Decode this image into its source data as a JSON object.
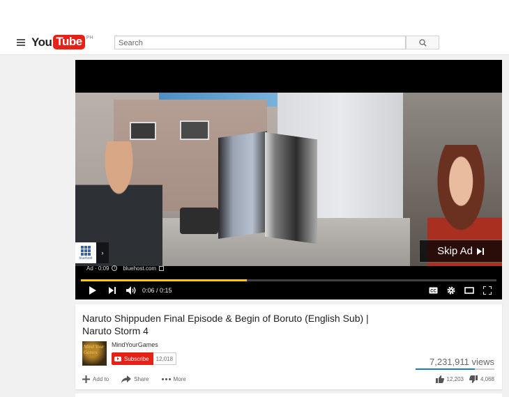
{
  "header": {
    "logo_you": "You",
    "logo_tube": "Tube",
    "logo_region": "PH",
    "search_placeholder": "Search",
    "icons": {
      "menu": "hamburger-menu-icon",
      "search": "search-icon"
    }
  },
  "player": {
    "ad_label": "Ad · 0:09",
    "ad_domain": "bluehost.com",
    "ad_brand": "bluehost",
    "skip_label": "Skip Ad",
    "current_time": "0:06",
    "duration": "0:15",
    "time_display": "0:06 / 0:15",
    "progress_fraction": 0.4,
    "progress_color": "#ffc800",
    "icons": [
      "play-icon",
      "next-icon",
      "volume-icon",
      "captions-icon",
      "settings-icon",
      "theater-mode-icon",
      "fullscreen-icon",
      "skip-icon",
      "info-icon",
      "external-link-icon"
    ]
  },
  "video": {
    "title": "Naruto Shippuden Final Episode & Begin of Boruto (English Sub) | Naruto Storm 4",
    "channel_name": "MindYourGames",
    "channel_thumb_text": "Mind Your Games",
    "subscribe_label": "Subscribe",
    "subscriber_count": "12,018",
    "views": "7,231,911 views",
    "like_ratio": 0.75,
    "actions": {
      "add_to": "Add to",
      "share": "Share",
      "more": "More"
    },
    "likes": "12,203",
    "dislikes": "4,068"
  },
  "colors": {
    "brand_red": "#e62117",
    "accent_blue": "#167ac6"
  }
}
